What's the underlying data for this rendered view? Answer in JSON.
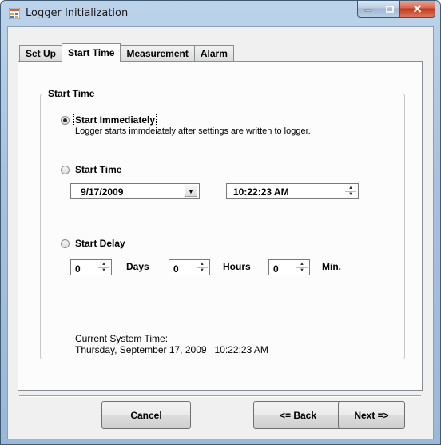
{
  "window": {
    "title": "Logger Initialization",
    "controls": {
      "minimize": "—",
      "maximize": "□",
      "close": "X"
    }
  },
  "tabs": [
    "Set Up",
    "Start Time",
    "Measurement",
    "Alarm"
  ],
  "active_tab": "Start Time",
  "group": {
    "title": "Start Time",
    "options": [
      {
        "label": "Start Immediately",
        "selected": true,
        "description": "Logger starts immdeiately after settings are written to logger."
      },
      {
        "label": "Start Time",
        "selected": false
      },
      {
        "label": "Start Delay",
        "selected": false
      }
    ],
    "start_date": "9/17/2009",
    "start_time": "10:22:23 AM",
    "delay": {
      "days_value": "0",
      "days_label": "Days",
      "hours_value": "0",
      "hours_label": "Hours",
      "min_value": "0",
      "min_label": "Min."
    },
    "system_time_label": "Current System Time:",
    "system_time_value": "Thursday, September 17, 2009   10:22:23 AM"
  },
  "buttons": {
    "cancel": "Cancel",
    "back": "<= Back",
    "next": "Next =>"
  },
  "icons": {
    "dropdown": "chevron-down-icon",
    "spin": "spin-updown-icon",
    "app": "app-window-icon"
  },
  "colors": {
    "titlebar": "#a7c2df",
    "client": "#f0f0f0",
    "close_button": "#c2391d"
  }
}
